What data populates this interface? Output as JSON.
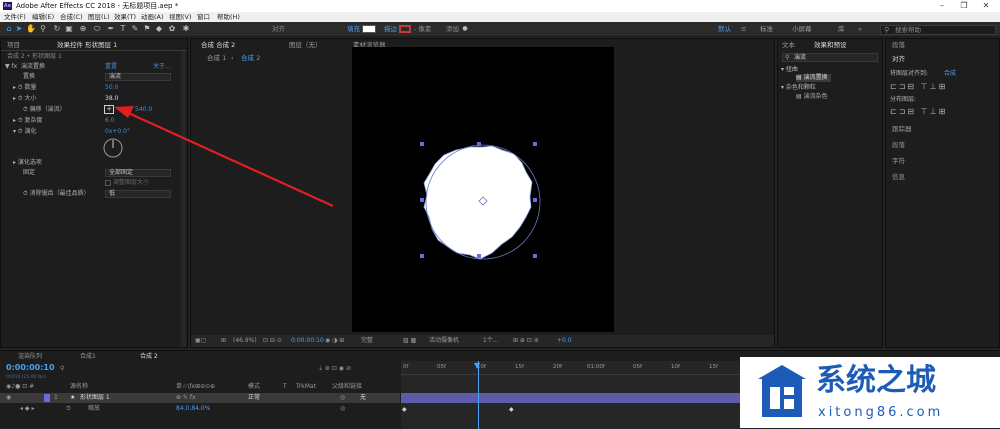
{
  "title_bar": {
    "app_title": "Adobe After Effects CC 2018 - 无标题项目.aep *",
    "logo_text": "Ae"
  },
  "menu": [
    "文件(F)",
    "编辑(E)",
    "合成(C)",
    "图层(L)",
    "效果(T)",
    "动画(A)",
    "视图(V)",
    "窗口",
    "帮助(H)"
  ],
  "toolbar": {
    "align_label": "对齐",
    "fill_label": "填充",
    "stroke_label": "描边",
    "stroke_width": "- 像素",
    "add_label": "添加",
    "workspaces": [
      "默认",
      "≡",
      "标准",
      "小屏幕",
      "库",
      "»"
    ],
    "search_placeholder": "搜索帮助"
  },
  "effect_controls": {
    "tab_project": "项目",
    "tab_effect": "效果控件 形状图层 1",
    "breadcrumb": "合成 2 • 形状图层 1",
    "effect_name": "湍流置换",
    "reset": "重置",
    "about": "关于...",
    "props": [
      {
        "label": "置换",
        "value": "湍流"
      },
      {
        "label": "数量",
        "value": "50.0"
      },
      {
        "label": "大小",
        "value": "38.0"
      },
      {
        "label": "偏移（湍流）",
        "value": "540.0"
      },
      {
        "label": "复杂度",
        "value": "6.0"
      },
      {
        "label": "演化",
        "value": "0x+0.0°"
      }
    ],
    "evolution_options": "演化选项",
    "pinning_label": "固定",
    "pinning_value": "全部固定",
    "resize_layer": "调整图层大小",
    "antialias_label": "消除锯齿（最佳品质）",
    "antialias_value": "低"
  },
  "composition": {
    "tab_comp": "合成 合成 2",
    "tab_layer": "图层（无）",
    "tab_footage": "素材浏览器",
    "nav": [
      "合成 1",
      "合成 2"
    ],
    "zoom": "(46.9%)",
    "timecode": "0:00:00:10",
    "quality": "完整",
    "camera": "活动摄像机",
    "views": "1个...",
    "exposure": "+0.0"
  },
  "effects_presets": {
    "tab_info": "文本",
    "tab_effects": "效果和预设",
    "search": "湍流",
    "groups": [
      {
        "name": "扭曲",
        "item": "湍流置换"
      },
      {
        "name": "杂色和颗粒",
        "item": "湍流杂色"
      }
    ]
  },
  "right_panel": {
    "tab": "段落",
    "align_title": "对齐",
    "align_to_label": "将图层对齐到:",
    "align_to_value": "合成",
    "distribute": "分布图层:",
    "items": [
      "跟踪器",
      "段落",
      "字符",
      "信息"
    ]
  },
  "timeline": {
    "tabs": [
      "渲染队列",
      "合成1",
      "合成 2"
    ],
    "timecode": "0:00:00:10",
    "fps_info": "00010 (25.00 fps)",
    "columns": [
      "源名称",
      "单☆\\fx⊞⊘⊙⊕",
      "模式",
      "T",
      "TrkMat",
      "父级和链接"
    ],
    "layer_num": "1",
    "layer_name": "形状图层 1",
    "layer_mode": "正常",
    "layer_parent": "无",
    "sub_prop": "缩放",
    "sub_value": "84.0,84.0%",
    "ruler": [
      "0f",
      "05f",
      "10f",
      "15f",
      "20f",
      "01:00f",
      "05f",
      "10f",
      "15f"
    ]
  },
  "watermark": {
    "brand": "系统之城",
    "url": "xitong86.com"
  },
  "colors": {
    "accent": "#3f8edf",
    "playhead": "#4aa0f0",
    "annotation_arrow": "#e02020",
    "layer_label": "#6a6ae0"
  }
}
